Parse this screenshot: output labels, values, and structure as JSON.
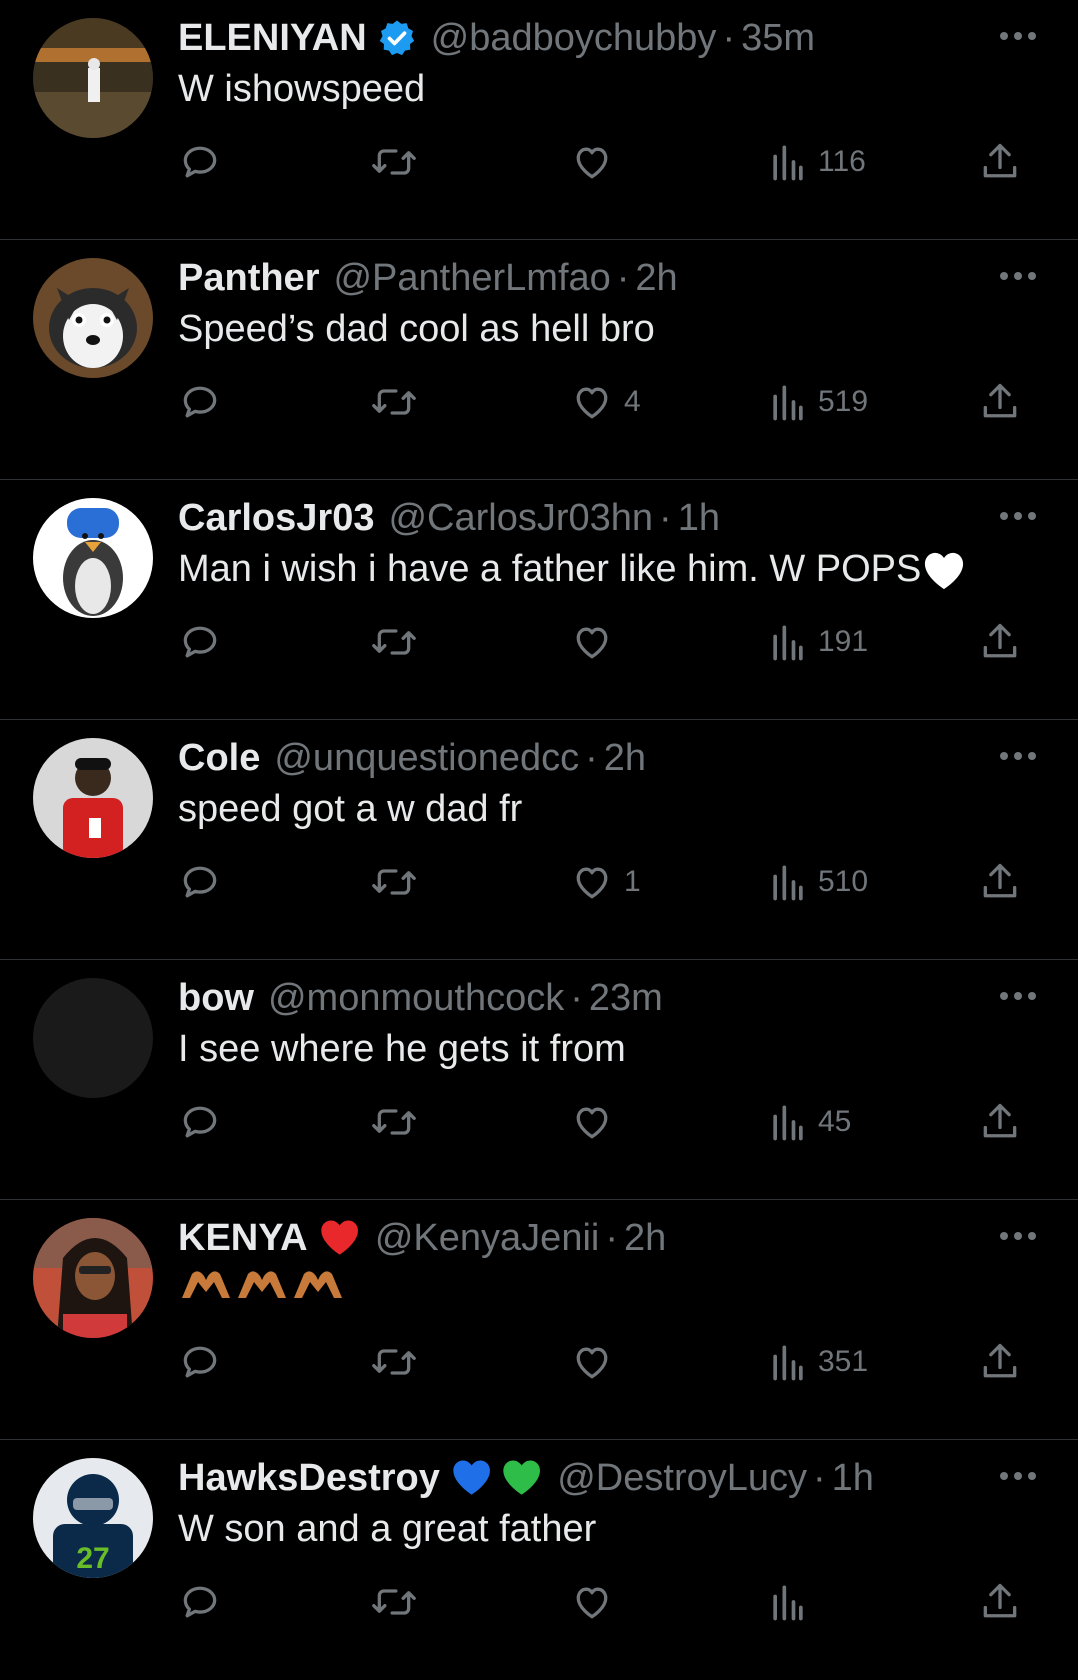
{
  "colors": {
    "background": "#000000",
    "text_primary": "#e7e9ea",
    "text_secondary": "#71767b",
    "divider": "#2f3336",
    "verified": "#1d9bf0"
  },
  "tweets": [
    {
      "display_name": "ELENIYAN",
      "handle": "@badboychubby",
      "separator": "·",
      "time": "35m",
      "text": "W ishowspeed",
      "likes": "",
      "views": "116",
      "badge_icon": "verified-badge-icon"
    },
    {
      "display_name": "Panther",
      "handle": "@PantherLmfao",
      "separator": "·",
      "time": "2h",
      "text": "Speed’s dad cool as hell bro",
      "likes": "4",
      "views": "519"
    },
    {
      "display_name": "CarlosJr03",
      "handle": "@CarlosJr03hn",
      "separator": "·",
      "time": "1h",
      "text": "Man i wish i have a father like him. W POPS",
      "text_emoji_icon": "white-heart-icon",
      "likes": "",
      "views": "191"
    },
    {
      "display_name": "Cole",
      "handle": "@unquestionedcc",
      "separator": "·",
      "time": "2h",
      "text": "speed got a w dad fr",
      "likes": "1",
      "views": "510"
    },
    {
      "display_name": "bow",
      "handle": "@monmouthcock",
      "separator": "·",
      "time": "23m",
      "text": "I see where he gets it from",
      "likes": "",
      "views": "45"
    },
    {
      "display_name": "KENYA",
      "handle": "@KenyaJenii",
      "separator": "·",
      "time": "2h",
      "text": "",
      "text_emoji_icon": "heart-hands-icon",
      "name_emoji_icon": "red-heart-icon",
      "likes": "",
      "views": "351"
    },
    {
      "display_name": "HawksDestroy",
      "handle": "@DestroyLucy",
      "separator": "·",
      "time": "1h",
      "text": "W son and a great father",
      "name_emoji_icon": "blue-green-hearts-icon",
      "likes": "",
      "views": ""
    }
  ]
}
